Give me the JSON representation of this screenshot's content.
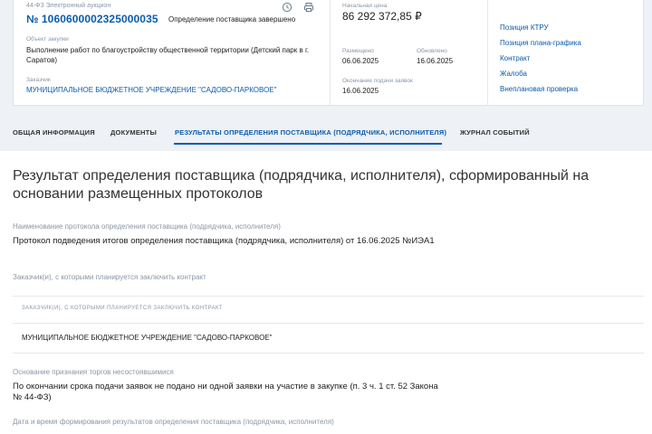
{
  "header": {
    "procedure_type": "44-ФЗ Электронный аукцион",
    "reg_number": "№ 1060600002325000035",
    "stage": "Определение поставщика завершено",
    "object_label": "Объект закупки",
    "object_value": "Выполнение работ по благоустройству общественной территории (Детский парк в г. Саратов)",
    "customer_label": "Заказчик",
    "customer_value": "МУНИЦИПАЛЬНОЕ БЮДЖЕТНОЕ УЧРЕЖДЕНИЕ \"САДОВО-ПАРКОВОЕ\"",
    "price_label": "Начальная цена",
    "price_value": "86 292 372,85 ₽",
    "placed_label": "Размещено",
    "placed_value": "06.06.2025",
    "updated_label": "Обновлено",
    "updated_value": "16.06.2025",
    "deadline_label": "Окончание подачи заявок",
    "deadline_value": "16.06.2025",
    "links": [
      "Позиция КТРУ",
      "Позиция плана-графика",
      "Контракт",
      "Жалоба",
      "Внеплановая проверка"
    ]
  },
  "tabs": [
    "ОБЩАЯ ИНФОРМАЦИЯ",
    "ДОКУМЕНТЫ",
    "РЕЗУЛЬТАТЫ ОПРЕДЕЛЕНИЯ ПОСТАВЩИКА (ПОДРЯДЧИКА, ИСПОЛНИТЕЛЯ)",
    "ЖУРНАЛ СОБЫТИЙ"
  ],
  "main": {
    "title": "Результат определения поставщика (подрядчика, исполнителя), сформированный на основании размещенных протоколов",
    "protocol_label": "Наименование протокола определения поставщика (подрядчика, исполнителя)",
    "protocol_value": "Протокол подведения итогов определения поставщика (подрядчика, исполнителя) от 16.06.2025 №ИЭА1",
    "customers_label": "Заказчик(и), с которыми планируется заключить контракт",
    "table_header": "ЗАКАЗЧИК(И), С КОТОРЫМИ ПЛАНИРУЕТСЯ ЗАКЛЮЧИТЬ КОНТРАКТ",
    "table_row": "МУНИЦИПАЛЬНОЕ БЮДЖЕТНОЕ УЧРЕЖДЕНИЕ \"САДОВО-ПАРКОВОЕ\"",
    "failure_label": "Основание признания торгов несостоявшимися",
    "failure_value": "По окончании срока подачи заявок не подано ни одной заявки на участие в закупке (п. 3 ч. 1 ст. 52 Закона № 44-ФЗ)",
    "datetime_label": "Дата и время формирования результатов определения поставщика (подрядчика, исполнителя)"
  },
  "icons": [
    "history-icon",
    "print-icon"
  ],
  "colors": {
    "accent": "#0a5cad",
    "muted": "#8a97a6",
    "bg": "#eef1f5"
  }
}
